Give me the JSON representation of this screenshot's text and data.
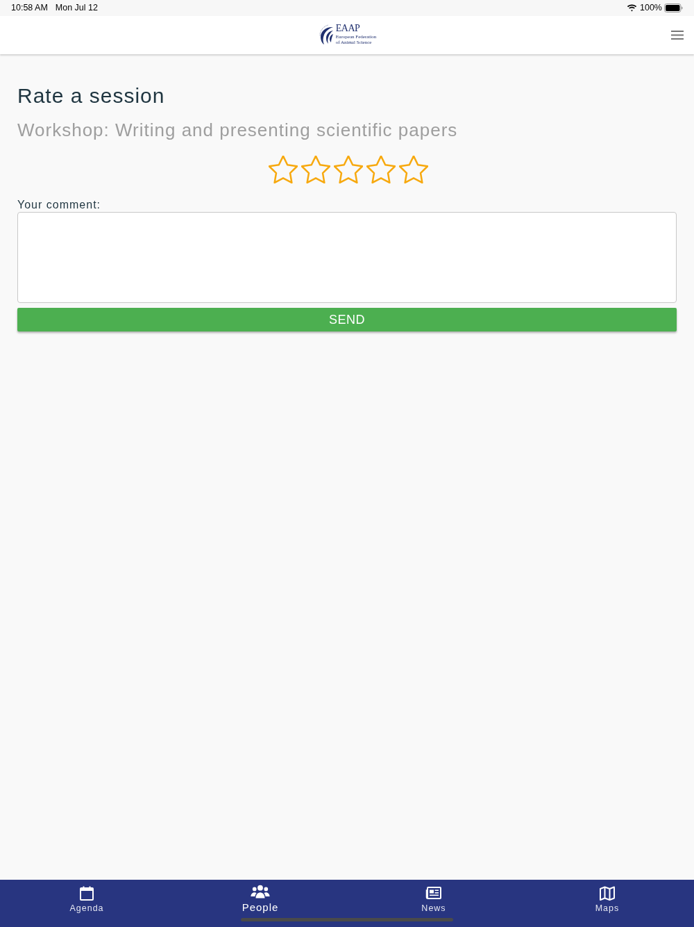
{
  "status_bar": {
    "time": "10:58 AM",
    "date": "Mon Jul 12",
    "battery": "100%"
  },
  "header": {
    "logo": {
      "title": "EAAP",
      "subtitle_lines": [
        "European Federation",
        "of Animal Science"
      ]
    }
  },
  "page": {
    "title": "Rate a session",
    "session": "Workshop: Writing and presenting scientific papers",
    "rating": {
      "stars": 0
    },
    "comment": {
      "label": "Your comment:"
    },
    "send_button": "SEND"
  },
  "tab_bar": [
    {
      "label": "Agenda",
      "selected": false
    },
    {
      "label": "People",
      "selected": true
    },
    {
      "label": "News",
      "selected": false
    },
    {
      "label": "Maps",
      "selected": false
    }
  ]
}
